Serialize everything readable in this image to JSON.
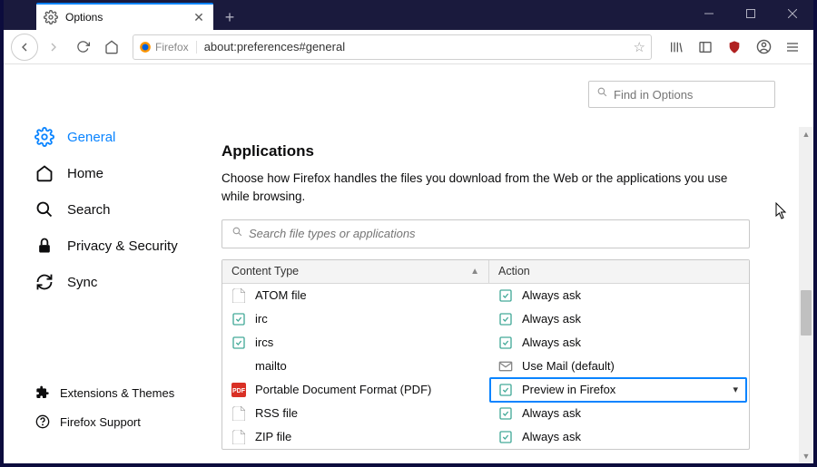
{
  "tab": {
    "title": "Options"
  },
  "urlbar": {
    "brand": "Firefox",
    "url": "about:preferences#general"
  },
  "search": {
    "find_placeholder": "Find in Options",
    "apps_placeholder": "Search file types or applications"
  },
  "sidebar": {
    "items": [
      {
        "label": "General"
      },
      {
        "label": "Home"
      },
      {
        "label": "Search"
      },
      {
        "label": "Privacy & Security"
      },
      {
        "label": "Sync"
      }
    ],
    "footer": [
      {
        "label": "Extensions & Themes"
      },
      {
        "label": "Firefox Support"
      }
    ]
  },
  "section": {
    "heading": "Applications",
    "description": "Choose how Firefox handles the files you download from the Web or the applications you use while browsing.",
    "columns": {
      "type": "Content Type",
      "action": "Action"
    }
  },
  "apps": [
    {
      "type": "ATOM file",
      "action": "Always ask",
      "icon": "file"
    },
    {
      "type": "irc",
      "action": "Always ask",
      "icon": "dial"
    },
    {
      "type": "ircs",
      "action": "Always ask",
      "icon": "dial"
    },
    {
      "type": "mailto",
      "action": "Use Mail (default)",
      "icon": "blank",
      "aicon": "mail"
    },
    {
      "type": "Portable Document Format (PDF)",
      "action": "Preview in Firefox",
      "icon": "pdf",
      "selected": true
    },
    {
      "type": "RSS file",
      "action": "Always ask",
      "icon": "file"
    },
    {
      "type": "ZIP file",
      "action": "Always ask",
      "icon": "file"
    }
  ]
}
